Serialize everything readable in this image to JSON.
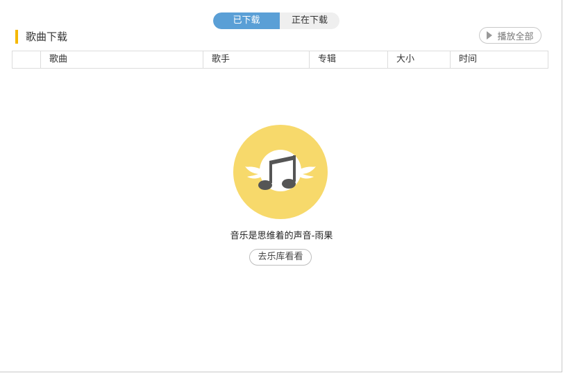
{
  "tabs": {
    "downloaded": "已下载",
    "downloading": "正在下载"
  },
  "section": {
    "title": "歌曲下载",
    "play_all": "播放全部"
  },
  "table": {
    "columns": [
      "",
      "歌曲",
      "歌手",
      "专辑",
      "大小",
      "时间"
    ]
  },
  "empty_state": {
    "icon": "music-note-with-wings-icon",
    "message": "音乐是思维着的声音-雨果",
    "button": "去乐库看看"
  },
  "colors": {
    "active_tab": "#5a9fd6",
    "accent_bar": "#f5b800",
    "icon_circle": "#f7d96b",
    "note": "#555555"
  }
}
